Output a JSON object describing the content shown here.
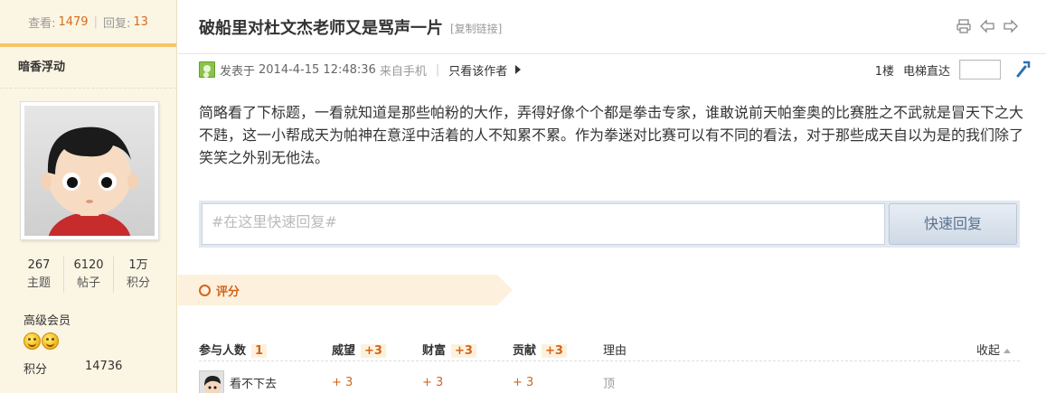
{
  "sidebar": {
    "views_label": "查看:",
    "views": "1479",
    "replies_label": "回复:",
    "replies": "13",
    "username": "暗香浮动",
    "counts": [
      {
        "value": "267",
        "label": "主题"
      },
      {
        "value": "6120",
        "label": "帖子"
      },
      {
        "value": "1万",
        "label": "积分"
      }
    ],
    "group": "高级会员",
    "credit_label": "积分",
    "credit_value": "14736"
  },
  "post": {
    "title": "破船里对杜文杰老师又是骂声一片",
    "copy_link": "[复制链接]",
    "posted_prefix": "发表于",
    "posted_time": "2014-4-15 12:48:36",
    "posted_from": "来自手机",
    "only_author": "只看该作者",
    "floor": "1楼",
    "elevator": "电梯直达",
    "content": "简略看了下标题，一看就知道是那些帕粉的大作，弄得好像个个都是拳击专家，谁敢说前天帕奎奥的比赛胜之不武就是冒天下之大不韪，这一小帮成天为帕神在意淫中活着的人不知累不累。作为拳迷对比赛可以有不同的看法，对于那些成天自以为是的我们除了笑笑之外别无他法。"
  },
  "quick_reply": {
    "placeholder": "#在这里快速回复#",
    "button": "快速回复"
  },
  "rating": {
    "title": "评分",
    "headers": {
      "participants": "参与人数",
      "participants_count": "1",
      "prestige": "威望",
      "prestige_total": "+3",
      "wealth": "财富",
      "wealth_total": "+3",
      "contribution": "贡献",
      "contribution_total": "+3",
      "reason": "理由",
      "collapse": "收起"
    },
    "rows": [
      {
        "user": "看不下去",
        "prestige": "+ 3",
        "wealth": "+ 3",
        "contribution": "+ 3",
        "reason": "顶"
      }
    ]
  },
  "colors": {
    "accent": "#d3651b",
    "sidebar_bg": "#fbf5e3",
    "rate_bg": "#fdf1dd"
  },
  "icons": [
    "print-icon",
    "prev-thread-icon",
    "next-thread-icon",
    "mobile-online-icon",
    "elevator-go-icon"
  ]
}
